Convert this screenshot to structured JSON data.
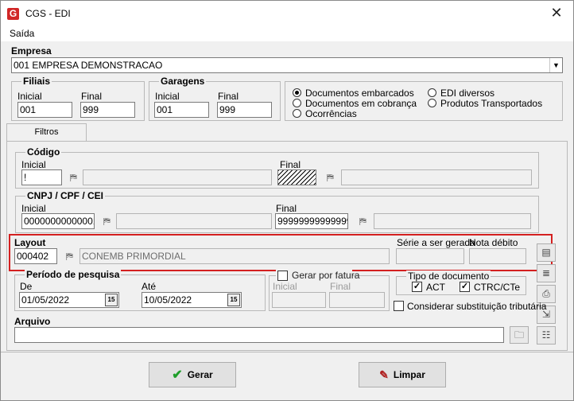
{
  "window": {
    "title": "CGS - EDI",
    "close_glyph": "✕",
    "app_icon": "cgs-logo-icon",
    "app_icon_letter": "G"
  },
  "menu": {
    "saida": "Saída"
  },
  "empresa": {
    "label": "Empresa",
    "value": "001 EMPRESA DEMONSTRACAO"
  },
  "filiais": {
    "title": "Filiais",
    "inicial_label": "Inicial",
    "inicial_value": "001",
    "final_label": "Final",
    "final_value": "999"
  },
  "garagens": {
    "title": "Garagens",
    "inicial_label": "Inicial",
    "inicial_value": "001",
    "final_label": "Final",
    "final_value": "999"
  },
  "tipo": {
    "options": [
      {
        "label": "Documentos embarcados",
        "selected": true
      },
      {
        "label": "Documentos em cobrança",
        "selected": false
      },
      {
        "label": "Ocorrências",
        "selected": false
      },
      {
        "label": "EDI diversos",
        "selected": false
      },
      {
        "label": "Produtos Transportados",
        "selected": false
      }
    ]
  },
  "tabs": {
    "filtros": "Filtros"
  },
  "codigo": {
    "title": "Código",
    "inicial_label": "Inicial",
    "inicial_value": "!",
    "final_label": "Final"
  },
  "cnpj": {
    "title": "CNPJ / CPF / CEI",
    "inicial_label": "Inicial",
    "inicial_value": "00000000000001",
    "final_label": "Final",
    "final_value": "99999999999999"
  },
  "layout": {
    "label": "Layout",
    "code": "000402",
    "description": "CONEMB PRIMORDIAL",
    "serie_label": "Série a ser gerada",
    "nota_label": "Nota débito"
  },
  "periodo": {
    "title": "Período de pesquisa",
    "de_label": "De",
    "de_value": "01/05/2022",
    "ate_label": "Até",
    "ate_value": "10/05/2022",
    "cal_glyph": "15"
  },
  "fatura": {
    "label": "Gerar por fatura",
    "checked": false,
    "inicial_label": "Inicial",
    "final_label": "Final"
  },
  "tipo_doc": {
    "title": "Tipo de documento",
    "act_label": "ACT",
    "act_checked": true,
    "ctrc_label": "CTRC/CTe",
    "ctrc_checked": true
  },
  "substituicao": {
    "label": "Considerar substituição tributária",
    "checked": false
  },
  "arquivo": {
    "label": "Arquivo"
  },
  "buttons": {
    "gerar": "Gerar",
    "limpar": "Limpar"
  },
  "colors": {
    "highlight": "#d42020",
    "gerar_check": "#1e9e2a",
    "title_icon": "#d12626"
  }
}
